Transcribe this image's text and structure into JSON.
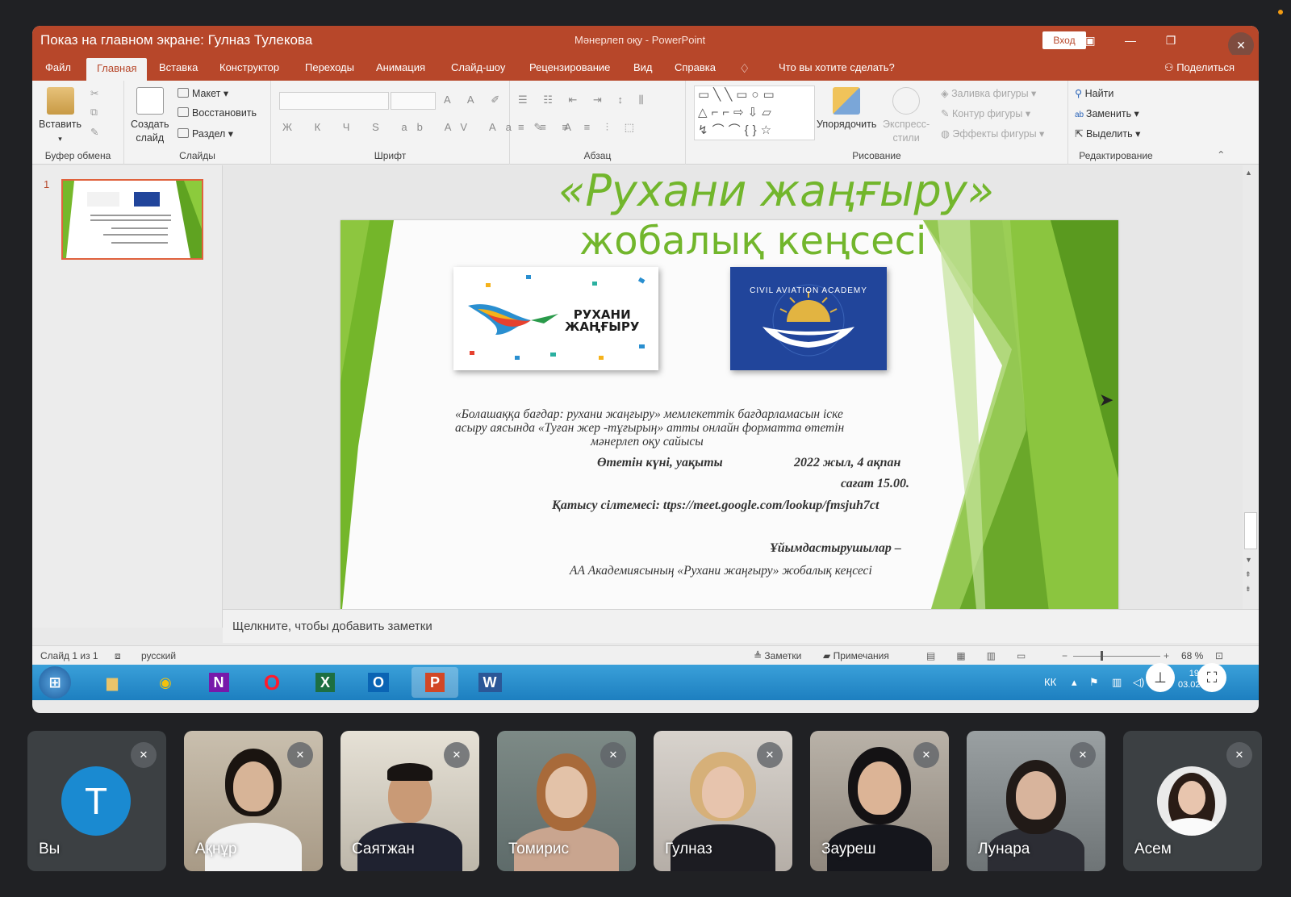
{
  "window": {
    "share_title": "Показ на главном экране: Гулназ Тулекова",
    "doc_title": "Мәнерлеп оқу  -  PowerPoint",
    "login_label": "Вход"
  },
  "tabs": [
    "Файл",
    "Главная",
    "Вставка",
    "Конструктор",
    "Переходы",
    "Анимация",
    "Слайд-шоу",
    "Рецензирование",
    "Вид",
    "Справка"
  ],
  "tell_me": "Что вы хотите сделать?",
  "share_label": "Поделиться",
  "ribbon": {
    "paste": "Вставить",
    "new_slide_1": "Создать",
    "new_slide_2": "слайд",
    "layout": "Макет",
    "reset": "Восстановить",
    "section": "Раздел",
    "arrange": "Упорядочить",
    "styles_1": "Экспресс-",
    "styles_2": "стили",
    "fill": "Заливка фигуры",
    "outline": "Контур фигуры",
    "effects": "Эффекты фигуры",
    "find": "Найти",
    "replace": "Заменить",
    "select": "Выделить",
    "groups": {
      "clipboard": "Буфер обмена",
      "slides": "Слайды",
      "font": "Шрифт",
      "paragraph": "Абзац",
      "drawing": "Рисование",
      "editing": "Редактирование"
    }
  },
  "thumb_number": "1",
  "slide": {
    "title_line1": "«Рухани жаңғыру»",
    "title_line2": "жобалық кеңсесі",
    "logo1_line1": "РУХАНИ",
    "logo1_line2": "ЖАҢҒЫРУ",
    "logo2_text": "CIVIL AVIATION ACADEMY",
    "desc_line1": "«Болашаққа бағдар: рухани жаңғыру» мемлекеттік бағдарламасын іске",
    "desc_line2": "асыру аясында «Туған жер -тұғырың» атты онлайн форматта өтетін",
    "desc_line3": "мәнерлеп оқу сайысы",
    "date_label": "Өтетін күні, уақыты",
    "date_value": "2022 жыл, 4 ақпан",
    "time_value": "сағат 15.00.",
    "link_line": "Қатысу сілтемесі: ttps://meet.google.com/lookup/fmsjuh7ct",
    "organizers_label": "Ұйымдастырушылар –",
    "organizers_value": "АА Академиясының «Рухани жаңғыру» жобалық кеңсесі"
  },
  "notes_placeholder": "Щелкните, чтобы добавить заметки",
  "status": {
    "slide_info": "Слайд 1 из 1",
    "language": "русский",
    "notes": "Заметки",
    "comments": "Примечания",
    "zoom": "68 %"
  },
  "taskbar": {
    "lang": "КК",
    "time": "19:09",
    "date": "03.02.2022"
  },
  "participants": [
    "Вы",
    "Ақнұр",
    "Саятжан",
    "Томирис",
    "Гулназ",
    "Зауреш",
    "Лунара",
    "Асем"
  ],
  "avatar_letter": "Т",
  "colors": {
    "powerpoint": "#b7472a",
    "slide_green": "#72b62c",
    "meet_bg": "#202124",
    "avatar_blue": "#1a8ad1"
  }
}
